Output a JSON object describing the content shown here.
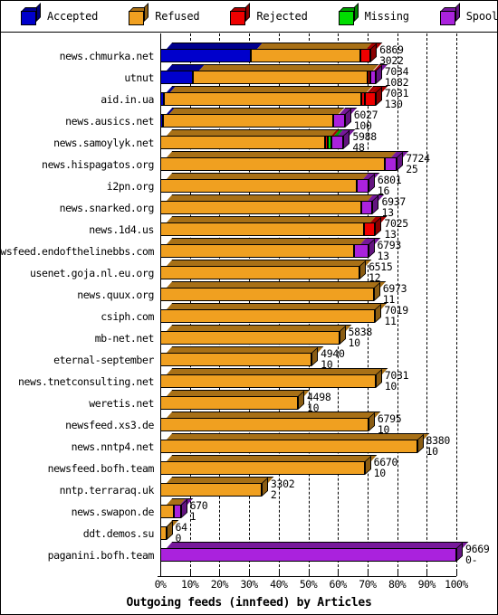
{
  "legend": {
    "items": [
      {
        "label": "Accepted",
        "color": "#0000cc",
        "icon": "cube-icon"
      },
      {
        "label": "Refused",
        "color": "#f0a020",
        "icon": "cube-icon"
      },
      {
        "label": "Rejected",
        "color": "#ee0000",
        "icon": "cube-icon"
      },
      {
        "label": "Missing",
        "color": "#00dd00",
        "icon": "cube-icon"
      },
      {
        "label": "Spooled",
        "color": "#aa22dd",
        "icon": "cube-icon"
      }
    ]
  },
  "chart_data": {
    "type": "bar",
    "orientation": "horizontal",
    "stacked": true,
    "title": "",
    "xlabel": "Outgoing feeds (innfeed) by Articles",
    "ylabel": "",
    "xlim": [
      0,
      115
    ],
    "xticks": [
      "0%",
      "10%",
      "20%",
      "30%",
      "40%",
      "50%",
      "60%",
      "70%",
      "80%",
      "90%",
      "100%"
    ],
    "xtick_values": [
      0,
      10,
      20,
      30,
      40,
      50,
      60,
      70,
      80,
      90,
      100
    ],
    "grid": "vertical-dashed",
    "legend_position": "top",
    "series": [
      {
        "name": "Accepted",
        "color": "#0000cc"
      },
      {
        "name": "Refused",
        "color": "#f0a020"
      },
      {
        "name": "Rejected",
        "color": "#ee0000"
      },
      {
        "name": "Missing",
        "color": "#00dd00"
      },
      {
        "name": "Spooled",
        "color": "#aa22dd"
      }
    ],
    "categories": [
      "news.chmurka.net",
      "utnut",
      "aid.in.ua",
      "news.ausics.net",
      "news.samoylyk.net",
      "news.hispagatos.org",
      "i2pn.org",
      "news.snarked.org",
      "news.1d4.us",
      "newsfeed.endofthelinebbs.com",
      "usenet.goja.nl.eu.org",
      "news.quux.org",
      "csiph.com",
      "mb-net.net",
      "eternal-september",
      "news.tnetconsulting.net",
      "weretis.net",
      "newsfeed.xs3.de",
      "news.nntp4.net",
      "newsfeed.bofh.team",
      "nntp.terraraq.uk",
      "news.swapon.de",
      "ddt.demos.su",
      "paganini.bofh.team"
    ],
    "rows": [
      {
        "label": "news.chmurka.net",
        "total_label": "6869",
        "second_label": "3022",
        "total_pct": 71.0,
        "segments": [
          {
            "series": "Accepted",
            "pct": 30.5
          },
          {
            "series": "Refused",
            "pct": 37.0
          },
          {
            "series": "Rejected",
            "pct": 3.5
          }
        ]
      },
      {
        "label": "utnut",
        "total_label": "7034",
        "second_label": "1082",
        "total_pct": 72.7,
        "segments": [
          {
            "series": "Accepted",
            "pct": 11.1
          },
          {
            "series": "Refused",
            "pct": 58.8
          },
          {
            "series": "Rejected",
            "pct": 1.0
          },
          {
            "series": "Spooled",
            "pct": 1.8
          }
        ]
      },
      {
        "label": "aid.in.ua",
        "total_label": "7031",
        "second_label": "130",
        "total_pct": 72.7,
        "segments": [
          {
            "series": "Accepted",
            "pct": 1.3
          },
          {
            "series": "Refused",
            "pct": 66.5
          },
          {
            "series": "Rejected",
            "pct": 1.3
          },
          {
            "series": "Rejected",
            "pct": 3.6
          }
        ]
      },
      {
        "label": "news.ausics.net",
        "total_label": "6027",
        "second_label": "100",
        "total_pct": 62.3,
        "segments": [
          {
            "series": "Accepted",
            "pct": 1.0
          },
          {
            "series": "Refused",
            "pct": 57.3
          },
          {
            "series": "Spooled",
            "pct": 4.0
          }
        ]
      },
      {
        "label": "news.samoylyk.net",
        "total_label": "5988",
        "second_label": "48",
        "total_pct": 61.9,
        "segments": [
          {
            "series": "Refused",
            "pct": 55.7
          },
          {
            "series": "Rejected",
            "pct": 1.0
          },
          {
            "series": "Missing",
            "pct": 1.2
          },
          {
            "series": "Spooled",
            "pct": 4.0
          }
        ]
      },
      {
        "label": "news.hispagatos.org",
        "total_label": "7724",
        "second_label": "25",
        "total_pct": 79.9,
        "segments": [
          {
            "series": "Refused",
            "pct": 75.9
          },
          {
            "series": "Spooled",
            "pct": 4.0
          }
        ]
      },
      {
        "label": "i2pn.org",
        "total_label": "6801",
        "second_label": "16",
        "total_pct": 70.3,
        "segments": [
          {
            "series": "Refused",
            "pct": 66.5
          },
          {
            "series": "Spooled",
            "pct": 3.8
          }
        ]
      },
      {
        "label": "news.snarked.org",
        "total_label": "6937",
        "second_label": "13",
        "total_pct": 71.7,
        "segments": [
          {
            "series": "Refused",
            "pct": 68.0
          },
          {
            "series": "Spooled",
            "pct": 3.7
          }
        ]
      },
      {
        "label": "news.1d4.us",
        "total_label": "7025",
        "second_label": "13",
        "total_pct": 72.6,
        "segments": [
          {
            "series": "Refused",
            "pct": 68.8
          },
          {
            "series": "Rejected",
            "pct": 3.8
          }
        ]
      },
      {
        "label": "newsfeed.endofthelinebbs.com",
        "total_label": "6793",
        "second_label": "13",
        "total_pct": 70.2,
        "segments": [
          {
            "series": "Refused",
            "pct": 65.3
          },
          {
            "series": "Spooled",
            "pct": 4.9
          }
        ]
      },
      {
        "label": "usenet.goja.nl.eu.org",
        "total_label": "6515",
        "second_label": "12",
        "total_pct": 67.3,
        "segments": [
          {
            "series": "Refused",
            "pct": 67.3
          }
        ]
      },
      {
        "label": "news.quux.org",
        "total_label": "6973",
        "second_label": "11",
        "total_pct": 72.1,
        "segments": [
          {
            "series": "Refused",
            "pct": 72.1
          }
        ]
      },
      {
        "label": "csiph.com",
        "total_label": "7019",
        "second_label": "11",
        "total_pct": 72.6,
        "segments": [
          {
            "series": "Refused",
            "pct": 72.6
          }
        ]
      },
      {
        "label": "mb-net.net",
        "total_label": "5838",
        "second_label": "10",
        "total_pct": 60.4,
        "segments": [
          {
            "series": "Refused",
            "pct": 60.4
          }
        ]
      },
      {
        "label": "eternal-september",
        "total_label": "4940",
        "second_label": "10",
        "total_pct": 51.1,
        "segments": [
          {
            "series": "Refused",
            "pct": 51.1
          }
        ]
      },
      {
        "label": "news.tnetconsulting.net",
        "total_label": "7031",
        "second_label": "10",
        "total_pct": 72.7,
        "segments": [
          {
            "series": "Refused",
            "pct": 72.7
          }
        ]
      },
      {
        "label": "weretis.net",
        "total_label": "4498",
        "second_label": "10",
        "total_pct": 46.5,
        "segments": [
          {
            "series": "Refused",
            "pct": 46.5
          }
        ]
      },
      {
        "label": "newsfeed.xs3.de",
        "total_label": "6795",
        "second_label": "10",
        "total_pct": 70.3,
        "segments": [
          {
            "series": "Refused",
            "pct": 70.3
          }
        ]
      },
      {
        "label": "news.nntp4.net",
        "total_label": "8380",
        "second_label": "10",
        "total_pct": 86.7,
        "segments": [
          {
            "series": "Refused",
            "pct": 86.7
          }
        ]
      },
      {
        "label": "newsfeed.bofh.team",
        "total_label": "6670",
        "second_label": "10",
        "total_pct": 69.0,
        "segments": [
          {
            "series": "Refused",
            "pct": 69.0
          }
        ]
      },
      {
        "label": "nntp.terraraq.uk",
        "total_label": "3302",
        "second_label": "2",
        "total_pct": 34.2,
        "segments": [
          {
            "series": "Refused",
            "pct": 34.2
          }
        ]
      },
      {
        "label": "news.swapon.de",
        "total_label": "670",
        "second_label": "1",
        "total_pct": 6.9,
        "segments": [
          {
            "series": "Refused",
            "pct": 4.6
          },
          {
            "series": "Spooled",
            "pct": 2.3
          }
        ]
      },
      {
        "label": "ddt.demos.su",
        "total_label": "64",
        "second_label": "0",
        "total_pct": 2.0,
        "segments": [
          {
            "series": "Refused",
            "pct": 2.0
          }
        ]
      },
      {
        "label": "paganini.bofh.team",
        "total_label": "9669",
        "second_label": "0-",
        "total_pct": 100.0,
        "segments": [
          {
            "series": "Spooled",
            "pct": 100.0
          }
        ]
      }
    ]
  }
}
